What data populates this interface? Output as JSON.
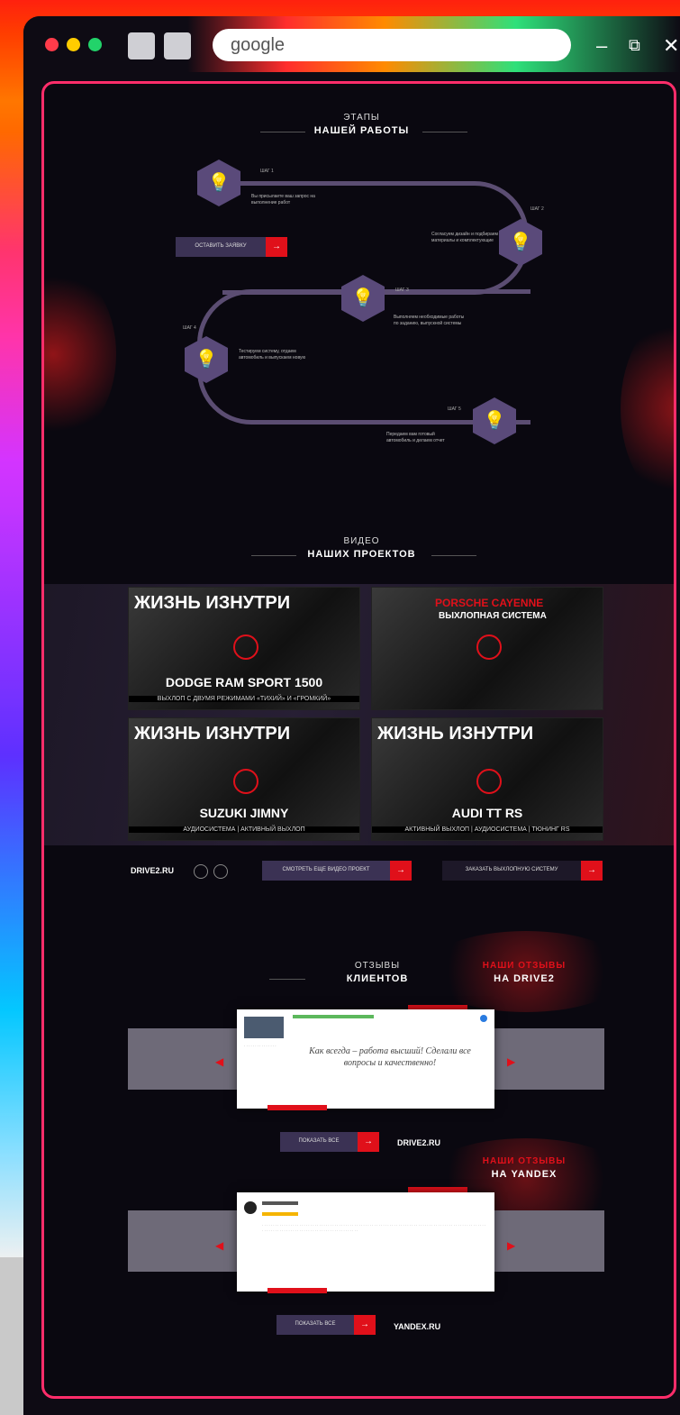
{
  "browser": {
    "address": "google",
    "window_controls": [
      "–",
      "⧉",
      "✕"
    ]
  },
  "stages": {
    "small_title": "ЭТАПЫ",
    "big_title": "НАШЕЙ РАБОТЫ",
    "cta": "ОСТАВИТЬ ЗАЯВКУ",
    "steps": [
      {
        "label": "ШАГ 1",
        "text": "Вы присылаете ваш запрос на выполнение работ"
      },
      {
        "label": "ШАГ 2",
        "text": "Согласуем дизайн и подбираем материалы и комплектующие"
      },
      {
        "label": "ШАГ 3",
        "text": "Выполняем необходимые работы по заданию, выпускной системы"
      },
      {
        "label": "ШАГ 4",
        "text": "Тестируем систему, отдаем автомобиль и выпускаем новую"
      },
      {
        "label": "ШАГ 5",
        "text": "Передаем вам готовый автомобиль и делаем отчет"
      }
    ]
  },
  "videos": {
    "small_title": "ВИДЕО",
    "big_title": "НАШИХ ПРОЕКТОВ",
    "items": [
      {
        "top": "ЖИЗНЬ ИЗНУТРИ",
        "bottom": "DODGE RAM SPORT 1500",
        "sub": "ВЫХЛОП С ДВУМЯ РЕЖИМАМИ «ТИХИЙ» И «ГРОМКИЙ»"
      },
      {
        "top": "PORSCHE CAYENNE",
        "bottom": "ВЫХЛОПНАЯ СИСТЕМА",
        "sub": ""
      },
      {
        "top": "ЖИЗНЬ ИЗНУТРИ",
        "bottom": "SUZUKI JIMNY",
        "sub": "АУДИОСИСТЕМА | АКТИВНЫЙ ВЫХЛОП"
      },
      {
        "top": "ЖИЗНЬ ИЗНУТРИ",
        "bottom": "AUDI TT RS",
        "sub": "АКТИВНЫЙ ВЫХЛОП | АУДИОСИСТЕМА | ТЮНИНГ RS"
      }
    ],
    "logo": "DRIVE2.RU",
    "cta_left": "СМОТРЕТЬ ЕЩЕ ВИДЕО ПРОЕКТ",
    "cta_right": "ЗАКАЗАТЬ ВЫХЛОПНУЮ СИСТЕМУ"
  },
  "reviews": {
    "small_title": "ОТЗЫВЫ",
    "big_title": "КЛИЕНТОВ",
    "drive2_small": "НАШИ ОТЗЫВЫ",
    "drive2_big": "НА DRIVE2",
    "quote": "Как всегда – работа высший! Сделали все вопросы и качественно!",
    "cta_drive2": "ПОКАЗАТЬ ВСЕ",
    "logo_drive2": "DRIVE2.RU",
    "yandex_small": "НАШИ ОТЗЫВЫ",
    "yandex_big": "НА YANDEX",
    "cta_yandex": "ПОКАЗАТЬ ВСЕ",
    "logo_yandex": "YANDEX.RU",
    "arrow_prev": "◀",
    "arrow_next": "▶"
  },
  "colors": {
    "accent": "#e0101a",
    "hex": "#5a4a7a",
    "background": "#0a0810"
  }
}
